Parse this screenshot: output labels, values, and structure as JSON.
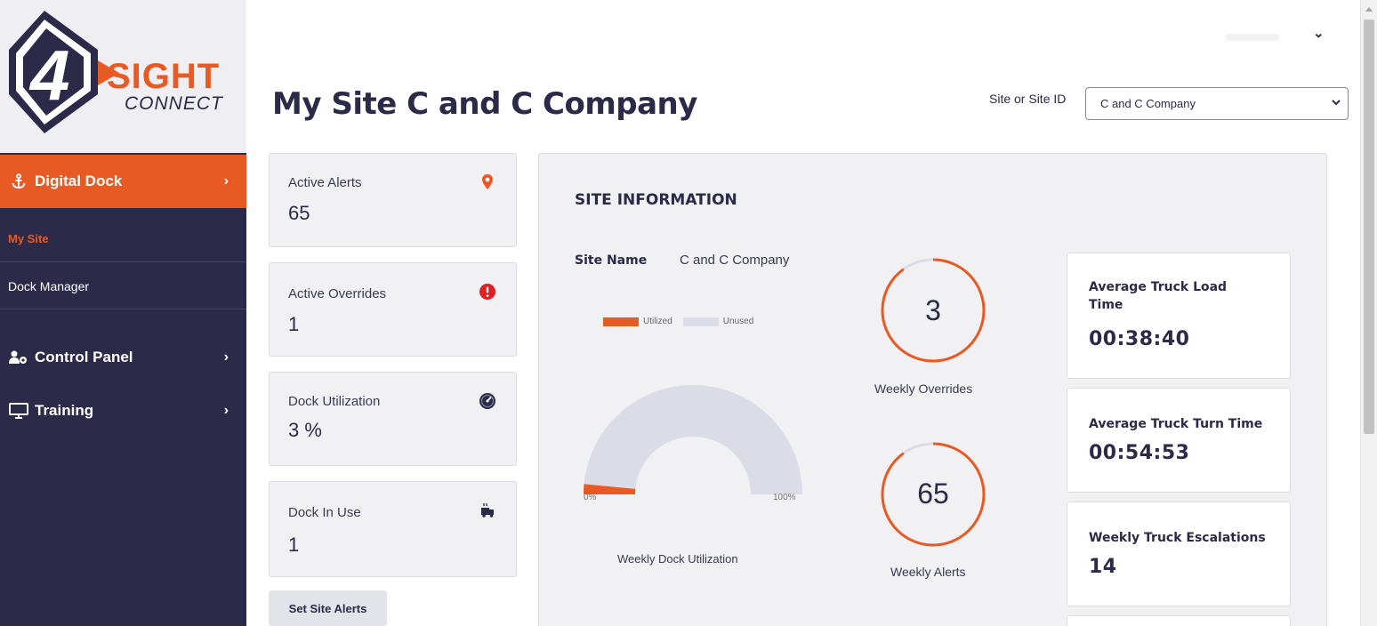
{
  "logo": {
    "sight_text": "SIGHT",
    "connect_text": "CONNECT",
    "mark": "4"
  },
  "sidebar": {
    "digital_dock": "Digital Dock",
    "my_site": "My Site",
    "dock_manager": "Dock Manager",
    "control_panel": "Control Panel",
    "training": "Training",
    "chevron": "›",
    "icons": {
      "digital_dock": "anchor-icon",
      "control_panel": "users-gear-icon",
      "training": "monitor-icon"
    }
  },
  "header": {
    "title": "My Site C and C Company",
    "site_label": "Site or Site ID",
    "site_value": "C and C Company",
    "user_chevron": "⌄"
  },
  "stats": {
    "active_alerts": {
      "label": "Active Alerts",
      "value": "65",
      "icon": "map-pin-icon"
    },
    "active_overrides": {
      "label": "Active Overrides",
      "value": "1",
      "icon": "alert-circle-icon"
    },
    "dock_utilization": {
      "label": "Dock Utilization",
      "value": "3 %",
      "icon": "gauge-icon"
    },
    "dock_in_use": {
      "label": "Dock In Use",
      "value": "1",
      "icon": "truck-icon"
    }
  },
  "set_alerts_button": "Set Site Alerts",
  "site_info": {
    "title": "SITE INFORMATION",
    "site_name_label": "Site Name",
    "site_name_value": "C and C Company",
    "legend_utilized": "Utilized",
    "legend_unused": "Unused",
    "gauge_min": "0%",
    "gauge_max": "100%",
    "gauge_caption": "Weekly Dock Utilization",
    "utilization_fraction": 0.03,
    "weekly_overrides": {
      "value": "3",
      "caption": "Weekly Overrides",
      "fill_fraction": 0.9
    },
    "weekly_alerts": {
      "value": "65",
      "caption": "Weekly Alerts",
      "fill_fraction": 0.9
    },
    "avg_load": {
      "label": "Average Truck Load Time",
      "value": "00:38:40"
    },
    "avg_turn": {
      "label": "Average Truck Turn Time",
      "value": "00:54:53"
    },
    "escalations": {
      "label": "Weekly Truck Escalations",
      "value": "14"
    }
  },
  "colors": {
    "accent": "#e85a24",
    "sidebar": "#2b2a48",
    "unused": "#dcdce6",
    "alert_red": "#e01e26"
  }
}
